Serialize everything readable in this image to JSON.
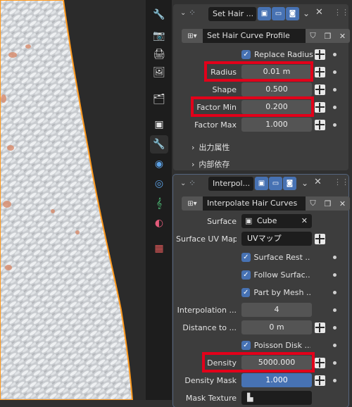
{
  "colors": {
    "accent_blue": "#4772b3",
    "panel_bg": "#3d3d3d",
    "field_bg": "#545454",
    "highlight_red": "#e2001a",
    "selection_outline": "#ff9a1f"
  },
  "tabs": [
    {
      "icon": "tool-icon"
    },
    {
      "icon": "render-icon"
    },
    {
      "icon": "output-icon"
    },
    {
      "icon": "view-layer-icon"
    },
    {
      "icon": "scene-icon"
    },
    {
      "icon": "world-icon"
    },
    {
      "icon": "collection-icon"
    },
    {
      "icon": "object-icon"
    },
    {
      "icon": "modifier-icon"
    },
    {
      "icon": "particles-icon"
    },
    {
      "icon": "physics-icon"
    },
    {
      "icon": "constraints-icon"
    },
    {
      "icon": "data-icon"
    },
    {
      "icon": "material-icon"
    },
    {
      "icon": "texture-icon"
    }
  ],
  "modifier1": {
    "name": "Set Hair ...",
    "node_group": "Set Hair Curve Profile",
    "replace_radius_label": "Replace Radius",
    "radius_label": "Radius",
    "radius_value": "0.01 m",
    "shape_label": "Shape",
    "shape_value": "0.500",
    "factor_min_label": "Factor Min",
    "factor_min_value": "0.200",
    "factor_max_label": "Factor Max",
    "factor_max_value": "1.000",
    "output_attributes": "出力属性",
    "internal_dependencies": "内部依存"
  },
  "modifier2": {
    "name": "Interpol...",
    "node_group": "Interpolate Hair Curves",
    "surface_label": "Surface",
    "surface_value": "Cube",
    "surface_uv_label": "Surface UV Map",
    "surface_uv_value": "UVマップ",
    "surface_rest_label": "Surface Rest ...",
    "follow_surface_label": "Follow Surfac...",
    "part_by_mesh_label": "Part by Mesh ...",
    "interp_label": "Interpolation ...",
    "interp_value": "4",
    "distance_label": "Distance to ...",
    "distance_value": "0 m",
    "poisson_label": "Poisson Disk ...",
    "density_label": "Density",
    "density_value": "5000.000",
    "density_mask_label": "Density Mask",
    "density_mask_value": "1.000",
    "mask_texture_label": "Mask Texture"
  }
}
